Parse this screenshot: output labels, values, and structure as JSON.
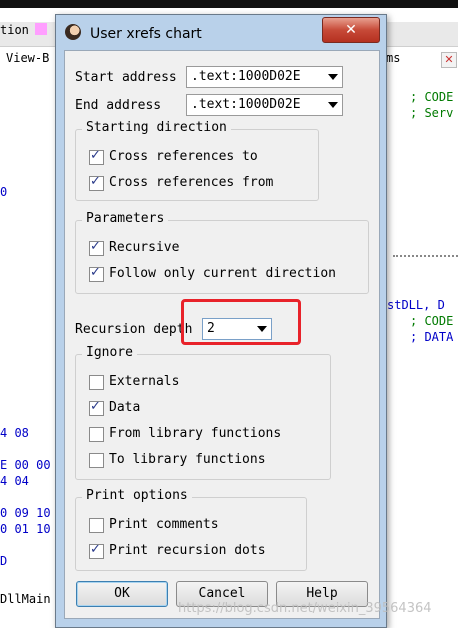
{
  "background": {
    "menu_left": "tion",
    "menu_view": "View-B",
    "menu_right": "ms",
    "code_comment_1": "; CODE",
    "code_comment_2": "; Serv",
    "func_ref": "stDLL, D",
    "code_comment_3": "; CODE",
    "code_comment_4": "; DATA",
    "hex_lines": [
      "0",
      "4 08",
      "E 00 00",
      "4 04",
      "0 09 10",
      "0 01 10",
      "D"
    ],
    "bottom_label": "DllMain"
  },
  "dialog": {
    "title": "User xrefs chart",
    "close_symbol": "✕",
    "start_address_label": "Start address",
    "start_address_value": ".text:1000D02E",
    "end_address_label": "End address",
    "end_address_value": ".text:1000D02E",
    "starting_direction": {
      "title": "Starting direction",
      "items": [
        {
          "label": "Cross references to",
          "checked": true
        },
        {
          "label": "Cross references from",
          "checked": true
        }
      ]
    },
    "parameters": {
      "title": "Parameters",
      "items": [
        {
          "label": "Recursive",
          "checked": true
        },
        {
          "label": "Follow only current direction",
          "checked": true
        }
      ]
    },
    "recursion_depth_label": "Recursion depth",
    "recursion_depth_value": "2",
    "ignore": {
      "title": "Ignore",
      "items": [
        {
          "label": "Externals",
          "checked": false
        },
        {
          "label": "Data",
          "checked": true
        },
        {
          "label": "From library functions",
          "checked": false
        },
        {
          "label": "To library functions",
          "checked": false
        }
      ]
    },
    "print_options": {
      "title": "Print options",
      "items": [
        {
          "label": "Print comments",
          "checked": false
        },
        {
          "label": "Print recursion dots",
          "checked": true
        }
      ]
    },
    "buttons": {
      "ok": "OK",
      "cancel": "Cancel",
      "help": "Help"
    }
  },
  "watermark": "https://blog.csdn.net/weixin_39564364"
}
